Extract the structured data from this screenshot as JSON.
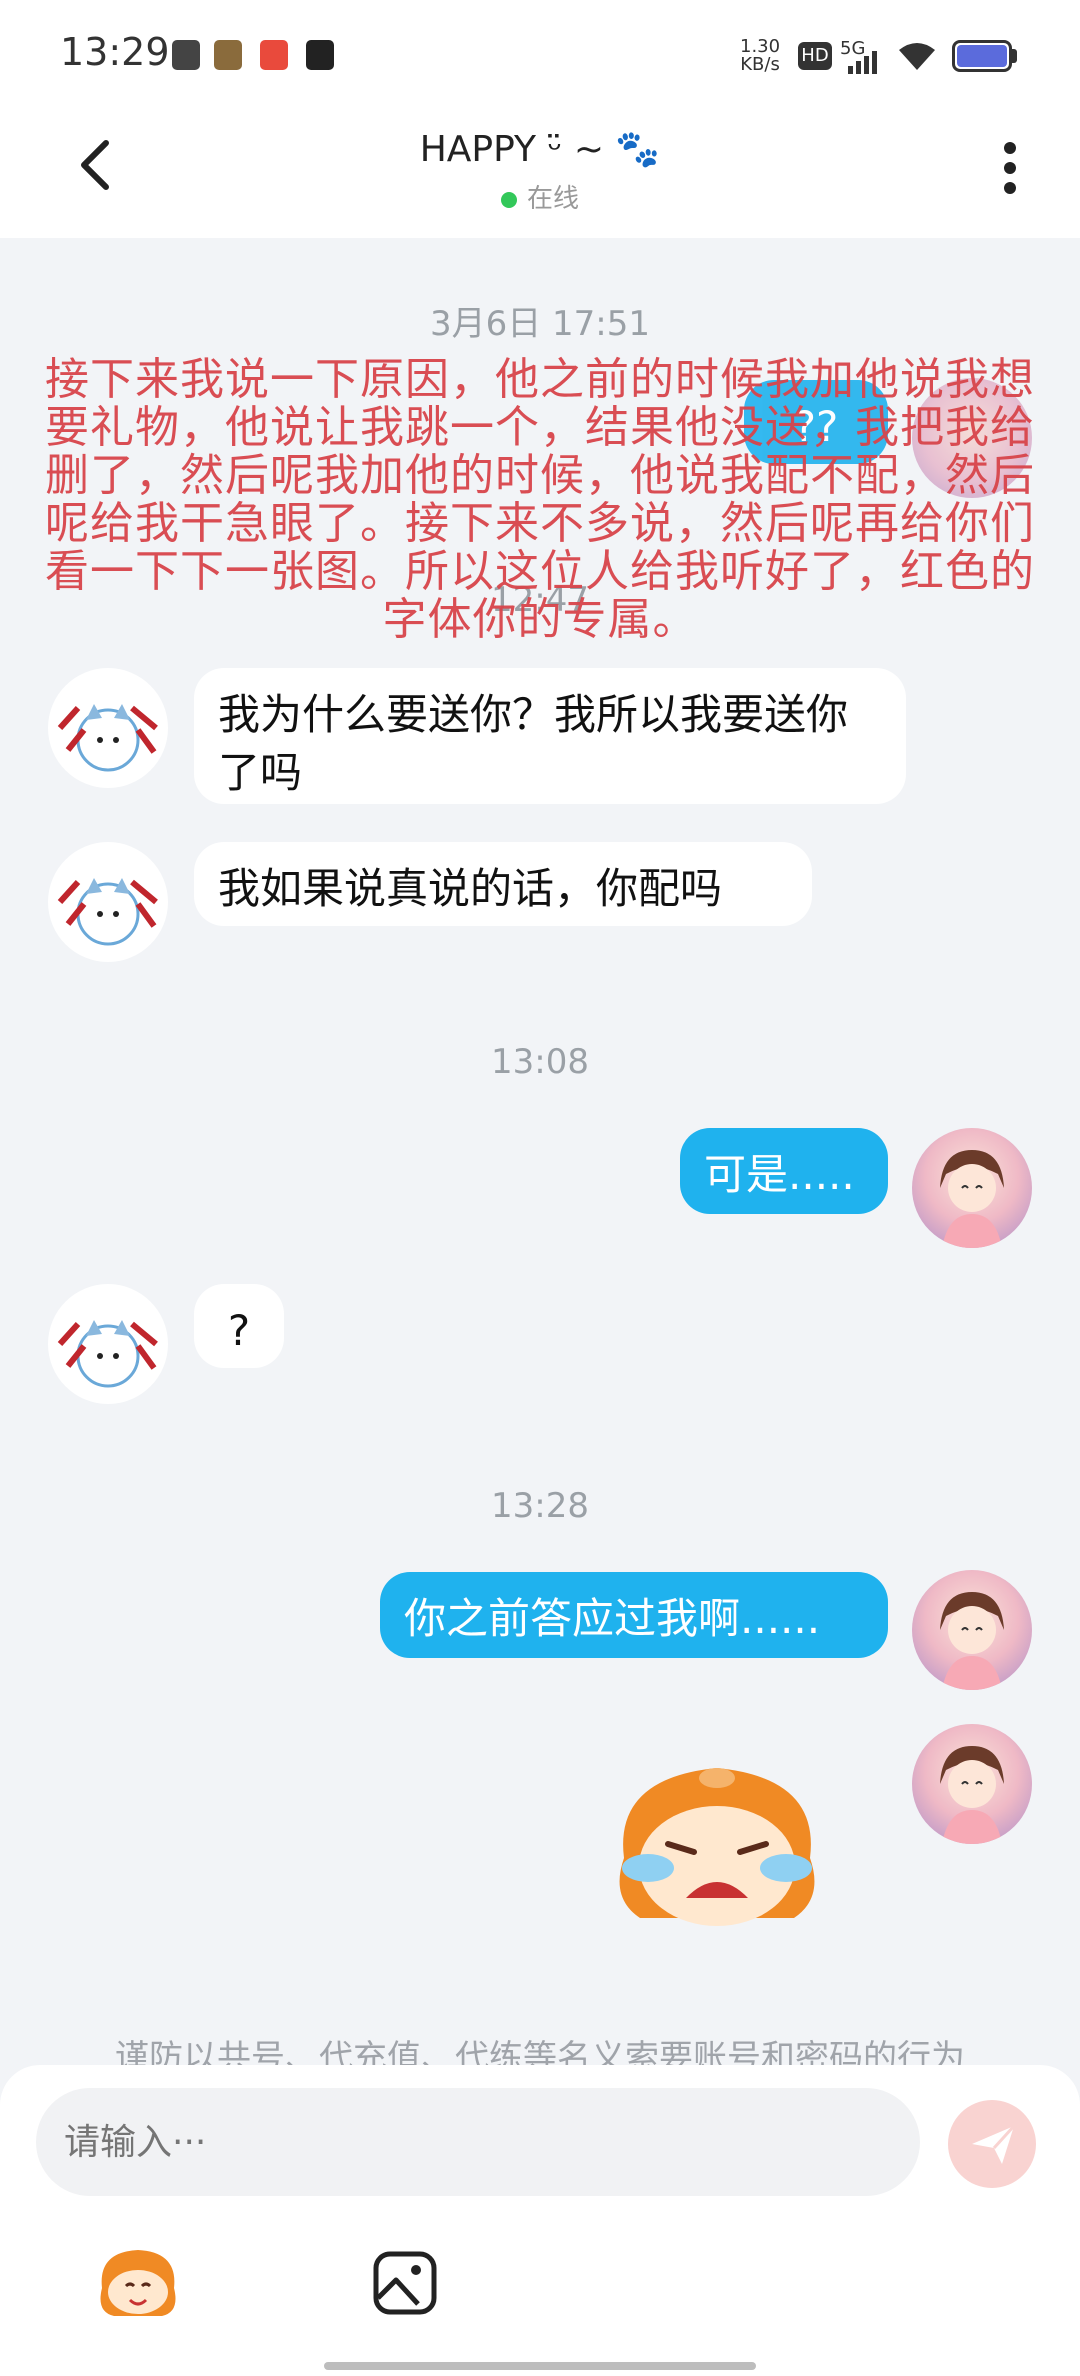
{
  "status_bar": {
    "time": "13:29",
    "net_speed_value": "1.30",
    "net_speed_unit": "KB/s",
    "hd": "HD",
    "network": "5G"
  },
  "header": {
    "title": "HAPPY ᵕ̈ ~ 🐾",
    "status": "在线"
  },
  "messages": {
    "ts1": "3月6日 17:51",
    "bubble_q_hidden": "??",
    "ts2": "12:47",
    "m1": "我为什么要送你？我所以我要送你了吗",
    "m2": "我如果说真说的话，你配吗",
    "ts3": "13:08",
    "m3": "可是.....",
    "m4": "?",
    "ts4": "13:28",
    "m5": "你之前答应过我啊......"
  },
  "overlay_text": "接下来我说一下原因，他之前的时候我加他说我想要礼物，他说让我跳一个，结果他没送，我把我给删了，然后呢我加他的时候，他说我配不配，然后呢给我干急眼了。接下来不多说，然后呢再给你们看一下下一张图。所以这位人给我听好了，红色的字体你的专属。",
  "notice": "谨防以共号、代充值、代练等名义索要账号和密码的行为",
  "input": {
    "placeholder": "请输入···"
  },
  "colors": {
    "outgoing": "#1fb2ee",
    "incoming": "#ffffff",
    "overlay": "#d8454b",
    "online": "#33c85a"
  },
  "icons": [
    "back-icon",
    "more-icon",
    "send-icon",
    "sticker-icon",
    "image-icon"
  ]
}
